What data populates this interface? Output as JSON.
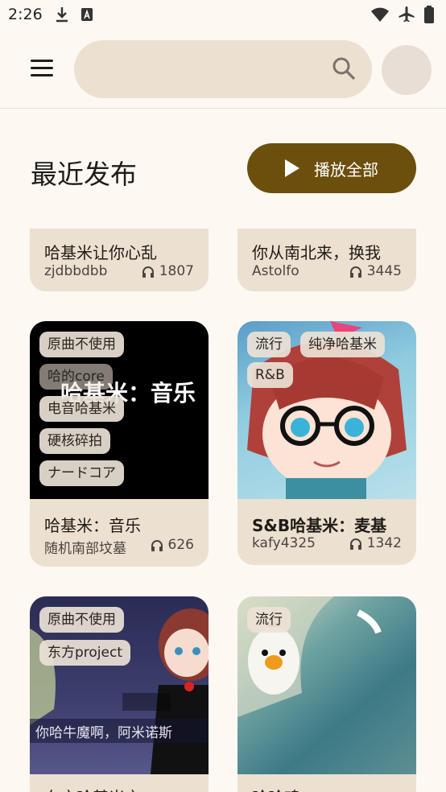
{
  "status": {
    "time": "2:26"
  },
  "search": {
    "placeholder": ""
  },
  "header": {
    "title": "最近发布",
    "play_all": "播放全部"
  },
  "cards": [
    {
      "title": "哈基米让你心乱",
      "author": "zjdbbdbb",
      "plays": "1807"
    },
    {
      "title": "你从南北来，换我",
      "author": "Astolfo",
      "plays": "3445"
    },
    {
      "title": "哈基米：音乐",
      "author": "随机南部坟墓",
      "plays": "626",
      "overlay": "哈基米：音乐",
      "tags": [
        "原曲不使用",
        "哈的core",
        "电音哈基米",
        "硬核碎拍",
        "ナードコア"
      ]
    },
    {
      "title": "S&B哈基米：麦基",
      "author": "kafy4325",
      "plays": "1342",
      "tags": [
        "流行",
        "纯净哈基米",
        "R&B"
      ]
    },
    {
      "title": "东方哈基米之",
      "caption": "你哈牛魔啊，阿米诺斯",
      "tags": [
        "原曲不使用",
        "东方project"
      ]
    },
    {
      "title": "哈哈鸡",
      "tags": [
        "流行"
      ]
    }
  ],
  "colors": {
    "accent": "#6c4f0c",
    "card": "#ece0d1",
    "background": "#fdf8f2"
  }
}
